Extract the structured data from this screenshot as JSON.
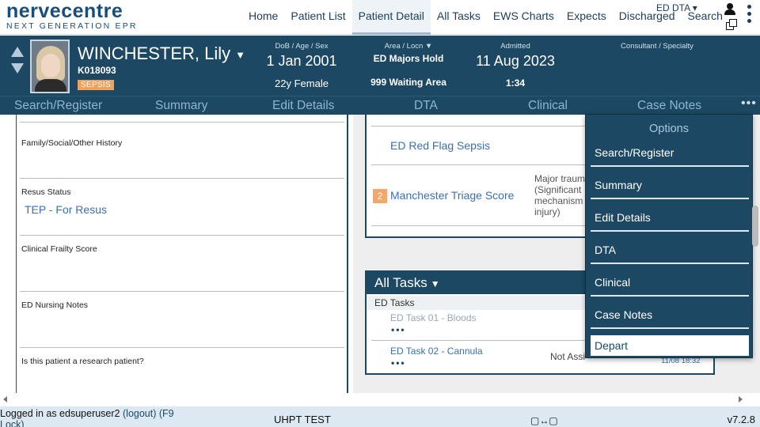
{
  "logo": {
    "main": "nervecentre",
    "sub": "NEXT GENERATION EPR"
  },
  "nav": {
    "items": [
      "Home",
      "Patient List",
      "Patient Detail",
      "All Tasks",
      "EWS Charts",
      "Expects",
      "Discharged",
      "Search"
    ],
    "active": "Patient Detail",
    "ed_dta": "ED DTA ▾"
  },
  "patient": {
    "name": "WINCHESTER, Lily",
    "id": "K018093",
    "badge": "SEPSIS",
    "dob_label": "DoB / Age / Sex",
    "dob": "1 Jan 2001",
    "age_sex": "22y Female",
    "location_label": "Area / Locn",
    "area": "ED Majors Hold",
    "location": "999 Waiting Area",
    "admitted_label": "Admitted",
    "admitted": "11 Aug 2023",
    "time": "1:34",
    "consultant_label": "Consultant / Specialty"
  },
  "subnav": {
    "items": [
      "Search/Register",
      "Summary",
      "Edit Details",
      "DTA",
      "Clinical",
      "Case Notes"
    ],
    "more": "•••"
  },
  "left_sections": [
    {
      "title": "Family/Social/Other History",
      "value": ""
    },
    {
      "title": "Resus Status",
      "value": "TEP - For Resus"
    },
    {
      "title": "Clinical Frailty Score",
      "value": ""
    },
    {
      "title": "ED Nursing Notes",
      "value": ""
    },
    {
      "title": "Is this patient a research patient?",
      "value": ""
    }
  ],
  "right_box": {
    "red_flag": "ED Red Flag Sepsis",
    "triage_badge": "2",
    "triage": "Manchester Triage Score",
    "triage_note": "Major trauma (Significant mechanism injury)"
  },
  "tasks": {
    "title": "All Tasks",
    "group": "ED Tasks",
    "items": [
      {
        "name": "ED Task 01 - Bloods",
        "status": "",
        "date": "",
        "color": "#9aa6b0"
      },
      {
        "name": "ED Task 02 - Cannula",
        "status": "Not Assi",
        "date": "11/08 18:32",
        "color": "#3b6fb0"
      }
    ],
    "dots": "•••"
  },
  "options": {
    "title": "Options",
    "items": [
      "Search/Register",
      "Summary",
      "Edit Details",
      "DTA",
      "Clinical",
      "Case Notes",
      "Depart"
    ],
    "selected": "Depart"
  },
  "footer": {
    "logged_in": "Logged in as edsuperuser2",
    "logout": "(logout)",
    "lock": "(F9 Lock)",
    "system": "UHPT TEST",
    "monitors": "▢↔▢",
    "version": "v7.2.8"
  },
  "colors": {
    "brand": "#1d4863",
    "link": "#3b6fb0",
    "sepsis": "#f0a25a"
  }
}
